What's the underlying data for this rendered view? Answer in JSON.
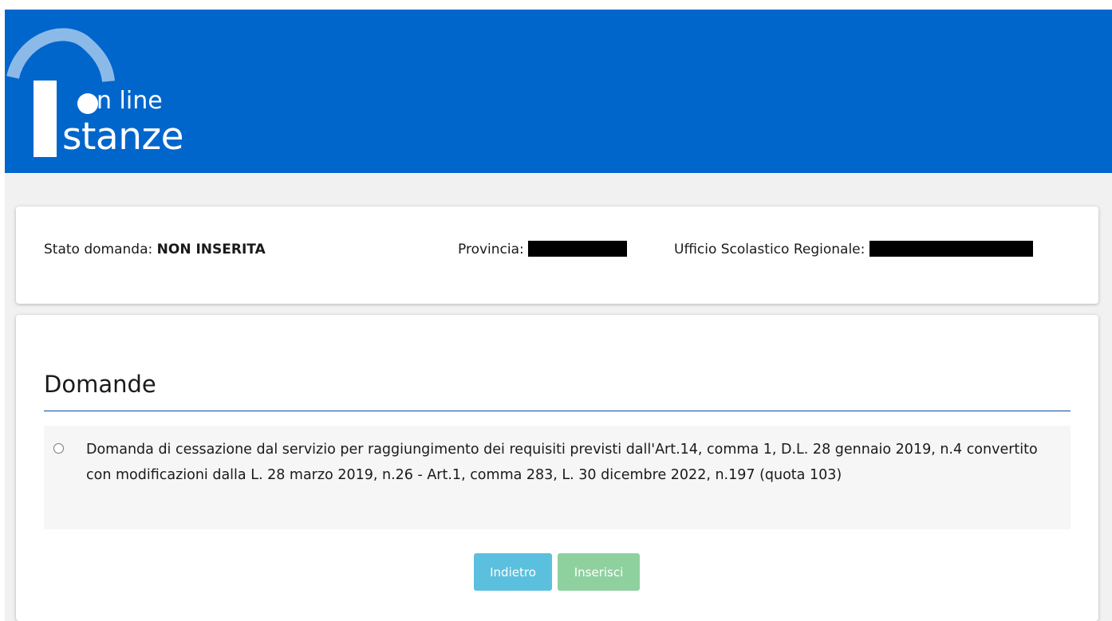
{
  "header": {
    "logo": {
      "line1": "On line",
      "line2": "Istanze",
      "line1_rest": "n line",
      "line2_rest": "stanze"
    },
    "color": "#0066cc"
  },
  "status": {
    "stato_label": "Stato domanda:",
    "stato_value": "NON INSERITA",
    "provincia_label": "Provincia:",
    "ufficio_label": "Ufficio Scolastico Regionale:"
  },
  "domande": {
    "title": "Domande",
    "options": [
      {
        "text": "Domanda di cessazione dal servizio per raggiungimento dei requisiti previsti dall'Art.14, comma 1, D.L. 28 gennaio 2019, n.4 convertito con modificazioni dalla L. 28 marzo 2019, n.26 - Art.1, comma 283, L. 30 dicembre 2022, n.197 (quota 103)",
        "selected": false
      }
    ]
  },
  "buttons": {
    "back_label": "Indietro",
    "insert_label": "Inserisci"
  },
  "colors": {
    "header_blue": "#0066cc",
    "btn_info": "#5bc0de",
    "btn_success_disabled": "#8fd19e"
  }
}
